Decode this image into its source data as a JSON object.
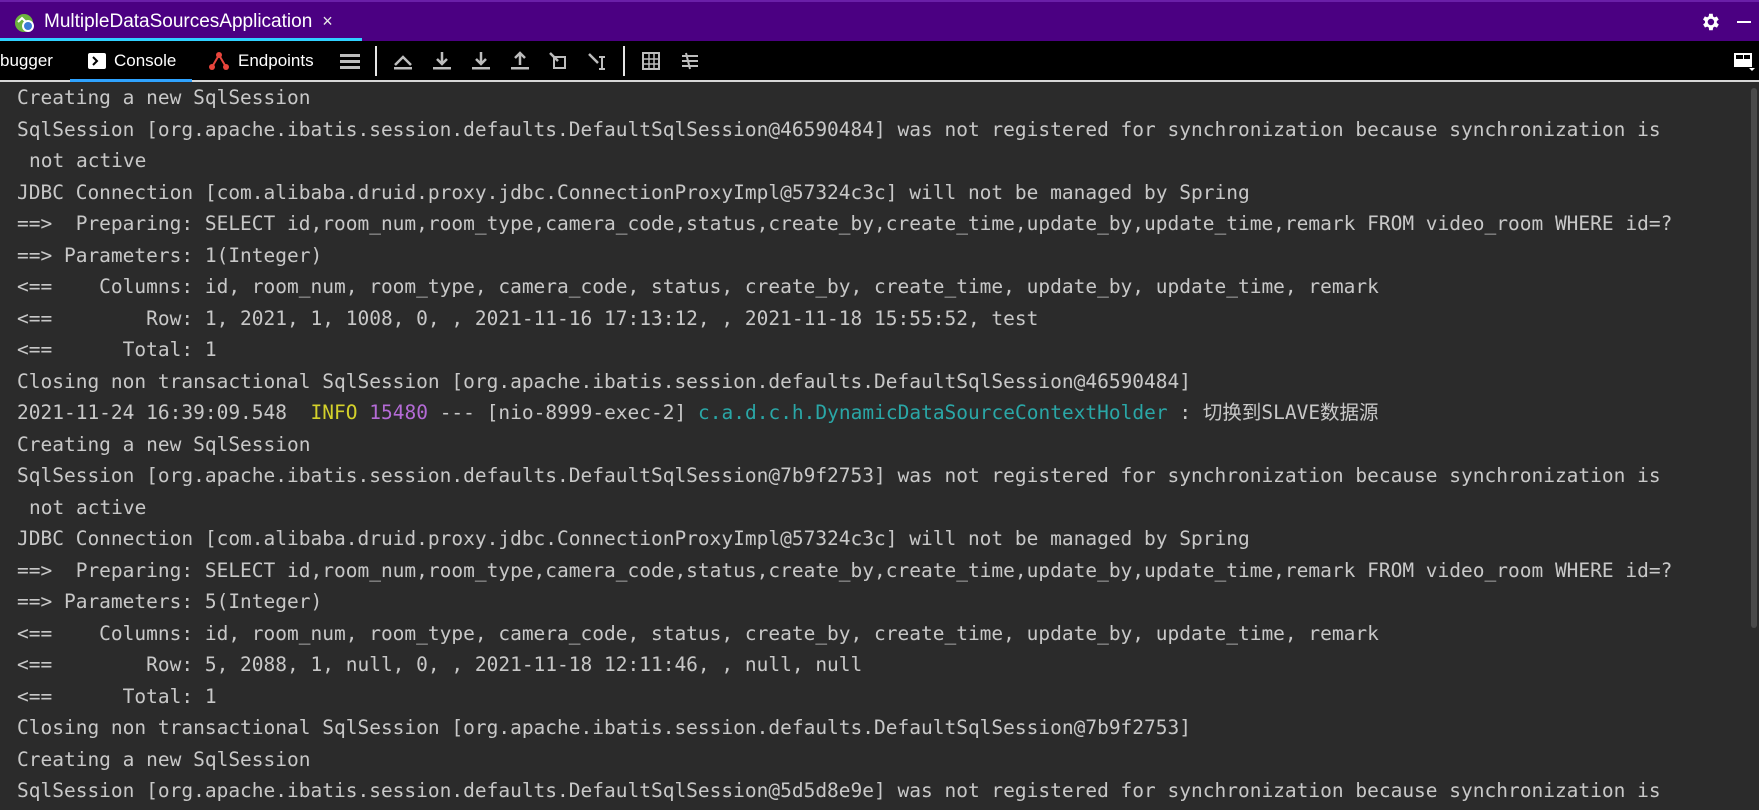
{
  "run_tab": {
    "title": "MultipleDataSourcesApplication",
    "close": "×",
    "icon": "spring-boot-app-icon"
  },
  "toolbar": {
    "tabs": [
      {
        "label": "bugger",
        "icon": "debugger-icon"
      },
      {
        "label": "Console",
        "icon": "console-icon"
      },
      {
        "label": "Endpoints",
        "icon": "endpoints-icon"
      }
    ]
  },
  "console": {
    "lines": [
      "Creating a new SqlSession",
      "SqlSession [org.apache.ibatis.session.defaults.DefaultSqlSession@46590484] was not registered for synchronization because synchronization is",
      "not active",
      "JDBC Connection [com.alibaba.druid.proxy.jdbc.ConnectionProxyImpl@57324c3c] will not be managed by Spring",
      "==>  Preparing: SELECT id,room_num,room_type,camera_code,status,create_by,create_time,update_by,update_time,remark FROM video_room WHERE id=?",
      "==> Parameters: 1(Integer)",
      "<==    Columns: id, room_num, room_type, camera_code, status, create_by, create_time, update_by, update_time, remark",
      "<==        Row: 1, 2021, 1, 1008, 0, , 2021-11-16 17:13:12, , 2021-11-18 15:55:52, test",
      "<==      Total: 1",
      "Closing non transactional SqlSession [org.apache.ibatis.session.defaults.DefaultSqlSession@46590484]"
    ],
    "log_entry": {
      "timestamp": "2021-11-24 16:39:09.548 ",
      "level": "INFO",
      "pid": "15480",
      "separator": "---",
      "thread": "[nio-8999-exec-2]",
      "logger": "c.a.d.c.h.DynamicDataSourceContextHolder",
      "message": ": 切换到SLAVE数据源"
    },
    "lines_after": [
      "Creating a new SqlSession",
      "SqlSession [org.apache.ibatis.session.defaults.DefaultSqlSession@7b9f2753] was not registered for synchronization because synchronization is",
      "not active",
      "JDBC Connection [com.alibaba.druid.proxy.jdbc.ConnectionProxyImpl@57324c3c] will not be managed by Spring",
      "==>  Preparing: SELECT id,room_num,room_type,camera_code,status,create_by,create_time,update_by,update_time,remark FROM video_room WHERE id=?",
      "==> Parameters: 5(Integer)",
      "<==    Columns: id, room_num, room_type, camera_code, status, create_by, create_time, update_by, update_time, remark",
      "<==        Row: 5, 2088, 1, null, 0, , 2021-11-18 12:11:46, , null, null",
      "<==      Total: 1",
      "Closing non transactional SqlSession [org.apache.ibatis.session.defaults.DefaultSqlSession@7b9f2753]",
      "Creating a new SqlSession",
      "SqlSession [org.apache.ibatis.session.defaults.DefaultSqlSession@5d5d8e9e] was not registered for synchronization because synchronization is"
    ]
  },
  "colors": {
    "run_bar": "#4b0082",
    "accent": "#2fd0ff",
    "console_bg": "#2b2b2b",
    "info": "#d4d12b",
    "pid": "#b46bd6",
    "logger": "#2aa7a7"
  }
}
